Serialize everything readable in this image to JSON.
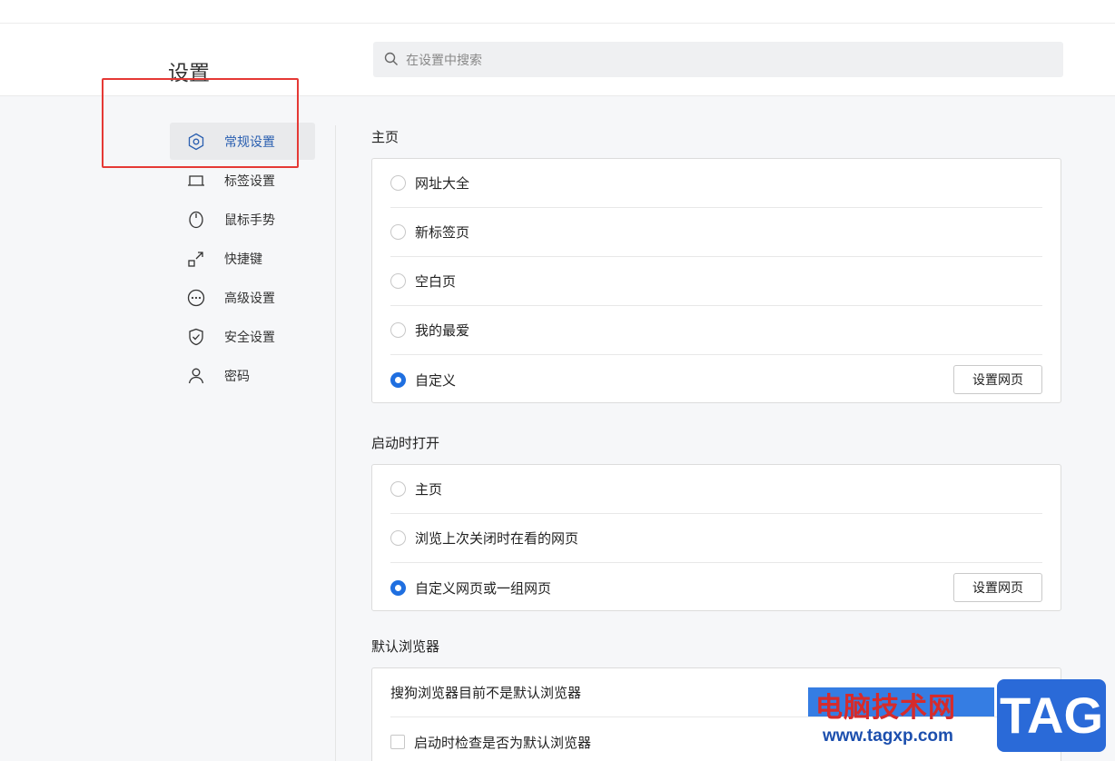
{
  "header": {
    "title": "设置",
    "search_placeholder": "在设置中搜索"
  },
  "sidebar": {
    "items": [
      {
        "label": "常规设置",
        "icon": "hexagon-settings-icon",
        "active": true
      },
      {
        "label": "标签设置",
        "icon": "tab-icon",
        "active": false
      },
      {
        "label": "鼠标手势",
        "icon": "mouse-icon",
        "active": false
      },
      {
        "label": "快捷键",
        "icon": "shortcut-icon",
        "active": false
      },
      {
        "label": "高级设置",
        "icon": "more-circle-icon",
        "active": false
      },
      {
        "label": "安全设置",
        "icon": "shield-icon",
        "active": false
      },
      {
        "label": "密码",
        "icon": "user-icon",
        "active": false
      }
    ]
  },
  "homepage": {
    "title": "主页",
    "options": [
      "网址大全",
      "新标签页",
      "空白页",
      "我的最爱",
      "自定义"
    ],
    "selected": "自定义",
    "button_label": "设置网页"
  },
  "startup": {
    "title": "启动时打开",
    "options": [
      "主页",
      "浏览上次关闭时在看的网页",
      "自定义网页或一组网页"
    ],
    "selected": "自定义网页或一组网页",
    "button_label": "设置网页"
  },
  "default_browser": {
    "title": "默认浏览器",
    "status_text": "搜狗浏览器目前不是默认浏览器",
    "check_label": "启动时检查是否为默认浏览器"
  },
  "watermark": {
    "title": "电脑技术网",
    "url": "www.tagxp.com",
    "badge": "TAG"
  },
  "colors": {
    "accent": "#1f6fe0",
    "annotation": "#e53935",
    "active_nav_text": "#2a5fb0"
  }
}
